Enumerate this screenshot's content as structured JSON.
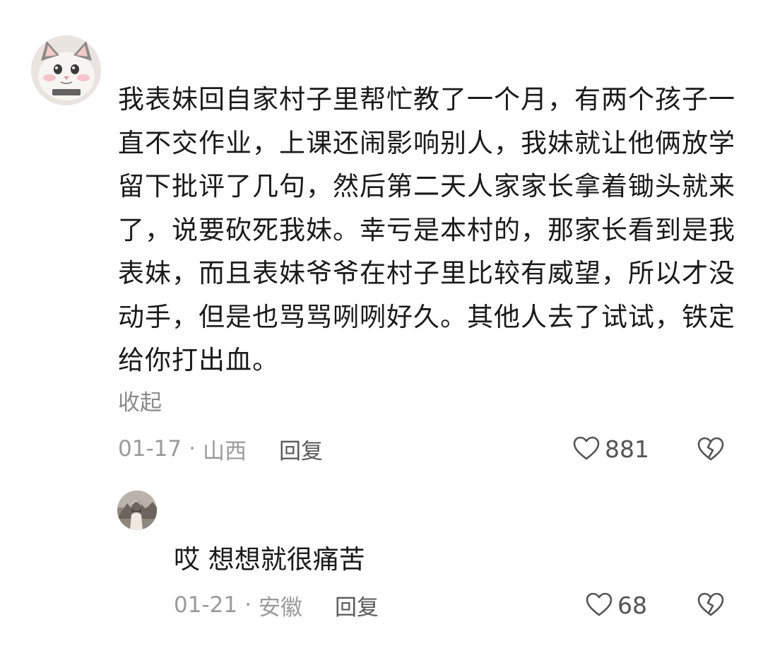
{
  "comment": {
    "text": "我表妹回自家村子里帮忙教了一个月，有两个孩子一直不交作业，上课还闹影响别人，我妹就让他俩放学留下批评了几句，然后第二天人家家长拿着锄头就来了，说要砍死我妹。幸亏是本村的，那家长看到是我表妹，而且表妹爷爷在村子里比较有威望，所以才没动手，但是也骂骂咧咧好久。其他人去了试试，铁定给你打出血。",
    "collapse_label": "收起",
    "date": "01-17",
    "separator": "·",
    "location": "山西",
    "reply_label": "回复",
    "likes": "881",
    "like_icon": "heart-outline-icon",
    "dislike_icon": "broken-heart-icon"
  },
  "reply": {
    "text": "哎 想想就很痛苦",
    "date": "01-21",
    "separator": "·",
    "location": "安徽",
    "reply_label": "回复",
    "likes": "68"
  },
  "colors": {
    "text": "#1a1a1a",
    "muted": "#9a9a9a",
    "icon": "#555555"
  }
}
